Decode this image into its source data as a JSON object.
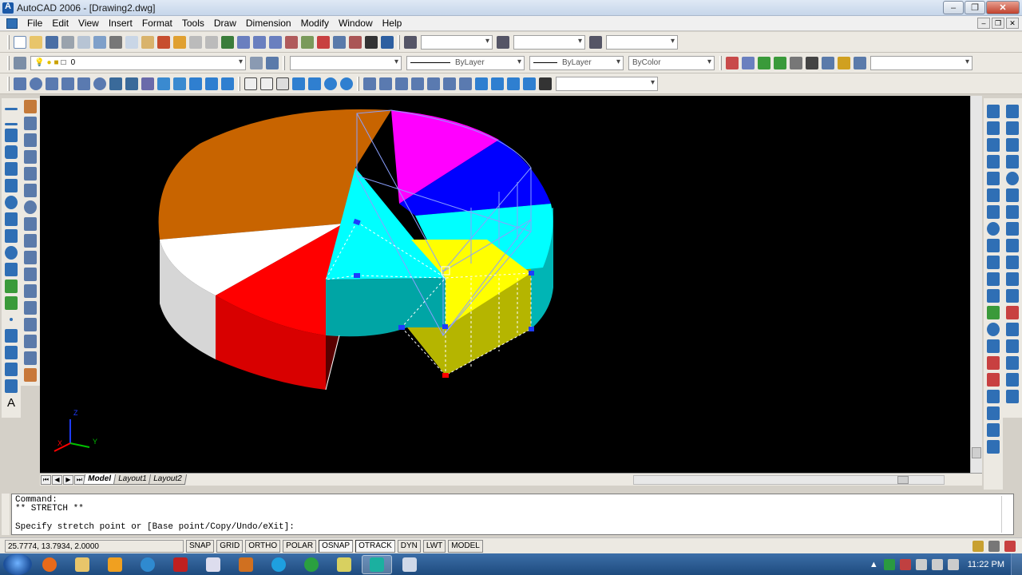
{
  "window": {
    "title": "AutoCAD 2006 - [Drawing2.dwg]",
    "controls": [
      "–",
      "❐",
      "✕"
    ],
    "mdi_controls": [
      "–",
      "❐",
      "✕"
    ]
  },
  "menu": [
    "File",
    "Edit",
    "View",
    "Insert",
    "Format",
    "Tools",
    "Draw",
    "Dimension",
    "Modify",
    "Window",
    "Help"
  ],
  "layers_toolbar": {
    "current_layer": "0"
  },
  "properties_toolbar": {
    "linetype": "ByLayer",
    "lineweight": "ByLayer",
    "plotstyle": "ByColor"
  },
  "layout_tabs": [
    "Model",
    "Layout1",
    "Layout2"
  ],
  "ucs_icon": {
    "x": "X",
    "y": "Y",
    "z": "Z"
  },
  "command": {
    "line1": "Command:",
    "line2": "** STRETCH **",
    "prompt": "Specify stretch point or [Base point/Copy/Undo/eXit]:"
  },
  "status": {
    "coords": "25.7774, 13.7934, 2.0000",
    "buttons": [
      "SNAP",
      "GRID",
      "ORTHO",
      "POLAR",
      "OSNAP",
      "OTRACK",
      "DYN",
      "LWT",
      "MODEL"
    ],
    "active": [
      "OSNAP",
      "OTRACK"
    ]
  },
  "taskbar": {
    "clock": "11:22 PM"
  },
  "colors": {
    "orange": "#c86400",
    "magenta": "#ff00ff",
    "blue": "#0000ff",
    "cyan": "#00ffff",
    "yellow": "#ffff00",
    "red": "#ff0000",
    "white": "#ffffff",
    "grip": "#1e3cff"
  }
}
